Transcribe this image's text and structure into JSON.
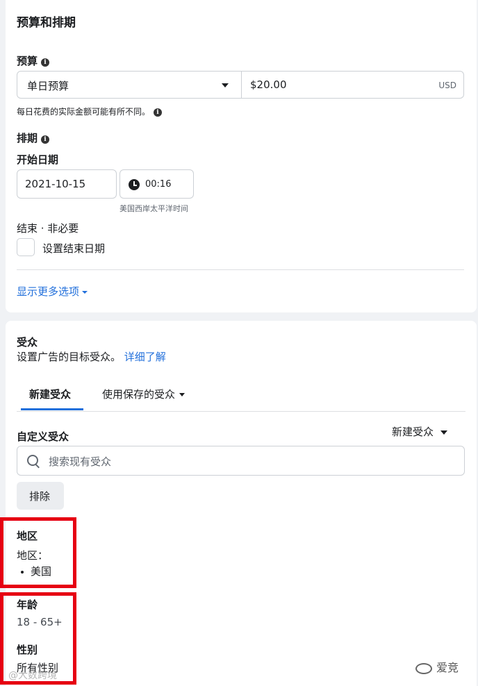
{
  "budget_section": {
    "title": "预算和排期",
    "budget_label": "预算",
    "budget_type": "单日预算",
    "amount": "$20.00",
    "currency": "USD",
    "amount_note": "每日花费的实际金额可能有所不同。",
    "schedule_label": "排期",
    "start_date_label": "开始日期",
    "start_date": "2021-10-15",
    "start_time": "00:16",
    "timezone": "美国西岸太平洋时间",
    "end_label": "结束 · 非必要",
    "end_checkbox_label": "设置结束日期",
    "more_options": "显示更多选项"
  },
  "audience_section": {
    "title": "受众",
    "description": "设置广告的目标受众。",
    "learn_more": "详细了解",
    "tabs": [
      {
        "label": "新建受众",
        "active": true
      },
      {
        "label": "使用保存的受众",
        "active": false
      }
    ],
    "custom_audience_label": "自定义受众",
    "create_new_label": "新建受众",
    "search_placeholder": "搜索现有受众",
    "exclude_button": "排除",
    "location_heading": "地区",
    "location_sub": "地区：",
    "location_value": "美国",
    "age_heading": "年龄",
    "age_value": "18 - 65+",
    "gender_heading": "性别",
    "gender_value": "所有性别"
  },
  "watermark": {
    "left": "@大数跨境",
    "right": "爱竞"
  },
  "colors": {
    "link": "#216fdb",
    "highlight": "#e60012",
    "background": "#f0f2f5"
  }
}
